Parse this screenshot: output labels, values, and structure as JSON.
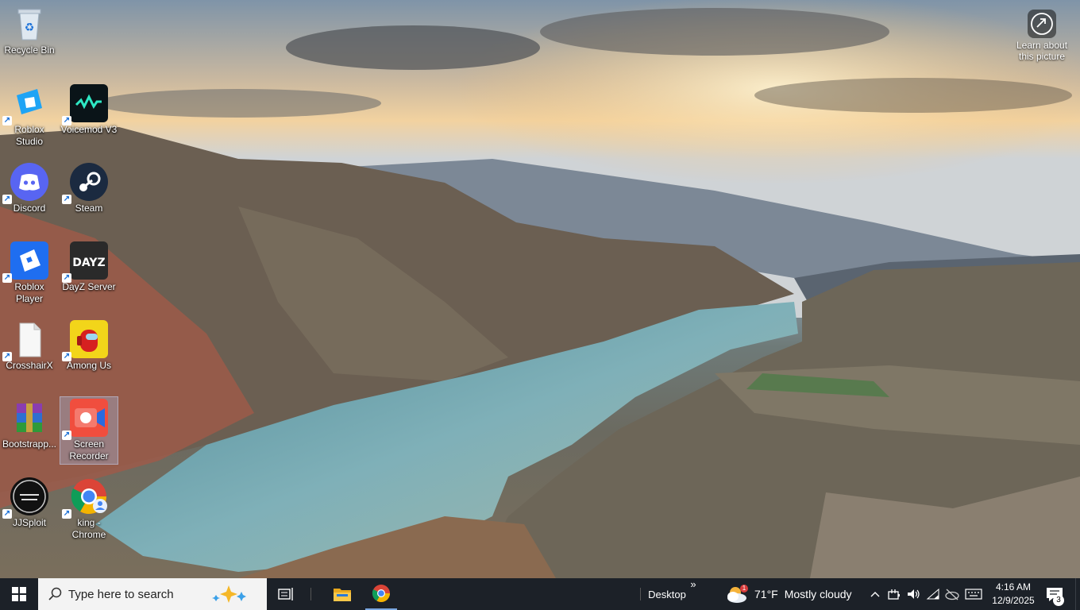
{
  "desktop_icons": [
    {
      "label": "Recycle Bin",
      "icon": "recycle-bin-icon"
    },
    {
      "label": "Roblox\nStudio",
      "icon": "roblox-studio-icon"
    },
    {
      "label": "Voicemod V3",
      "icon": "voicemod-icon"
    },
    {
      "label": "Discord",
      "icon": "discord-icon"
    },
    {
      "label": "Steam",
      "icon": "steam-icon"
    },
    {
      "label": "Roblox\nPlayer",
      "icon": "roblox-player-icon"
    },
    {
      "label": "DayZ Server",
      "icon": "dayz-server-icon"
    },
    {
      "label": "CrosshairX",
      "icon": "crosshairx-icon"
    },
    {
      "label": "Among Us",
      "icon": "among-us-icon"
    },
    {
      "label": "Bootstrapp...",
      "icon": "winrar-archive-icon"
    },
    {
      "label": "Screen\nRecorder",
      "icon": "screen-recorder-icon"
    },
    {
      "label": "JJSploit",
      "icon": "jjsploit-icon"
    },
    {
      "label": "king -\nChrome",
      "icon": "chrome-profile-icon"
    }
  ],
  "dayz_logo_text": "DAYZ",
  "learn_about": {
    "label": "Learn about\nthis picture",
    "icon": "camera-info-icon"
  },
  "taskbar": {
    "search_placeholder": "Type here to search",
    "desktop_toolbar": "Desktop",
    "toolbar_chevron": "»",
    "weather": {
      "temp": "71°F",
      "condition": "Mostly cloudy",
      "alert_count": "1"
    },
    "time": "4:16 AM",
    "date": "12/9/2025",
    "notification_count": "3"
  },
  "colors": {
    "taskbar_bg": "#1c2128",
    "search_bg": "#f3f3f3",
    "selection": "#a0bee6"
  }
}
